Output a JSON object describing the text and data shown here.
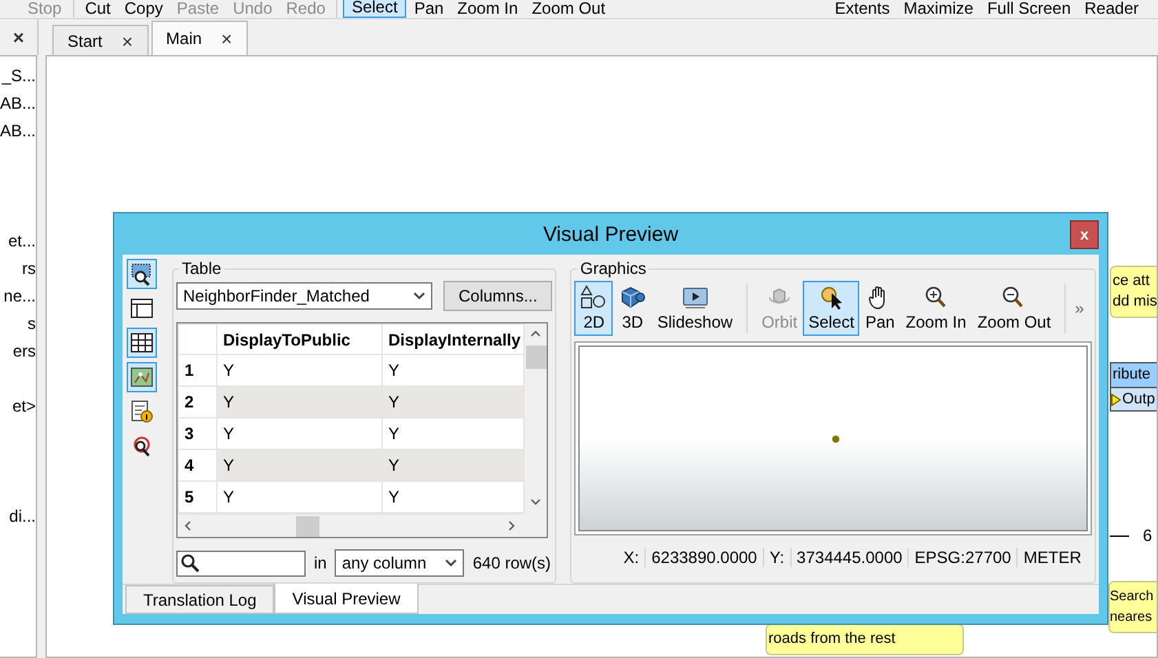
{
  "toolbar": {
    "groups": [
      [
        {
          "label": "Stop",
          "disabled": true,
          "selected": false
        }
      ],
      [
        {
          "label": "Cut",
          "disabled": false,
          "selected": false
        },
        {
          "label": "Copy",
          "disabled": false,
          "selected": false
        },
        {
          "label": "Paste",
          "disabled": true,
          "selected": false
        },
        {
          "label": "Undo",
          "disabled": true,
          "selected": false
        },
        {
          "label": "Redo",
          "disabled": true,
          "selected": false
        }
      ],
      [
        {
          "label": "Select",
          "disabled": false,
          "selected": true
        },
        {
          "label": "Pan",
          "disabled": false,
          "selected": false
        },
        {
          "label": "Zoom In",
          "disabled": false,
          "selected": false
        },
        {
          "label": "Zoom Out",
          "disabled": false,
          "selected": false
        }
      ]
    ],
    "right_items": [
      "Extents",
      "Maximize",
      "Full Screen",
      "Reader"
    ]
  },
  "left_panel": {
    "close": "×",
    "items": [
      "_S...",
      "AB...",
      "AB...",
      "et...",
      "rs",
      "ne...",
      "s",
      "ers",
      "et>",
      "di..."
    ]
  },
  "tabs": [
    {
      "label": "Start",
      "selected": false,
      "close": "×"
    },
    {
      "label": "Main",
      "selected": true,
      "close": "×"
    }
  ],
  "canvas": {
    "notes": [
      {
        "lines": [
          "ce att",
          "dd mis"
        ]
      },
      {
        "lines": [
          "roads from the rest"
        ]
      },
      {
        "lines": [
          "Search",
          "neares"
        ]
      }
    ],
    "node": {
      "title": "ribute",
      "port": "Outp"
    },
    "link_label": "6"
  },
  "dialog": {
    "title": "Visual Preview",
    "close": "x",
    "side_tools": [
      {
        "kind": "inspect",
        "selected": true
      },
      {
        "kind": "layout",
        "selected": false
      },
      {
        "kind": "table",
        "selected": true
      },
      {
        "kind": "map",
        "selected": true
      },
      {
        "kind": "info",
        "selected": false
      },
      {
        "kind": "bug",
        "selected": false
      }
    ],
    "table": {
      "group": "Table",
      "source": "NeighborFinder_Matched",
      "columns_button": "Columns...",
      "columns": [
        "DisplayToPublic",
        "DisplayInternally"
      ],
      "rows": [
        {
          "index": "1",
          "cells": [
            "Y",
            "Y"
          ]
        },
        {
          "index": "2",
          "cells": [
            "Y",
            "Y"
          ]
        },
        {
          "index": "3",
          "cells": [
            "Y",
            "Y"
          ]
        },
        {
          "index": "4",
          "cells": [
            "Y",
            "Y"
          ]
        },
        {
          "index": "5",
          "cells": [
            "Y",
            "Y"
          ]
        }
      ],
      "search": {
        "in": "in",
        "scope": "any column",
        "count": "640 row(s)"
      }
    },
    "graphics": {
      "group": "Graphics",
      "tools": [
        [
          {
            "label": "2D",
            "kind": "shapes",
            "selected": true,
            "disabled": false
          },
          {
            "label": "3D",
            "kind": "cube",
            "selected": false,
            "disabled": false
          },
          {
            "label": "Slideshow",
            "kind": "screen",
            "selected": false,
            "disabled": false
          }
        ],
        [
          {
            "label": "Orbit",
            "kind": "orbit",
            "selected": false,
            "disabled": true
          },
          {
            "label": "Select",
            "kind": "pointer",
            "selected": true,
            "disabled": false
          },
          {
            "label": "Pan",
            "kind": "hand",
            "selected": false,
            "disabled": false
          },
          {
            "label": "Zoom In",
            "kind": "zoomin",
            "selected": false,
            "disabled": false
          },
          {
            "label": "Zoom Out",
            "kind": "zoomout",
            "selected": false,
            "disabled": false
          }
        ]
      ],
      "more": "»",
      "status": [
        "X:",
        "6233890.0000",
        "Y:",
        "3734445.0000",
        "EPSG:27700",
        "METER"
      ]
    },
    "bottom_tabs": [
      {
        "label": "Translation Log",
        "selected": false
      },
      {
        "label": "Visual Preview",
        "selected": true
      }
    ]
  }
}
